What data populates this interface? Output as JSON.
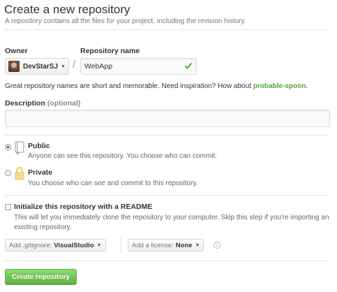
{
  "header": {
    "title": "Create a new repository",
    "subtitle": "A repository contains all the files for your project, including the revision history."
  },
  "owner": {
    "label": "Owner",
    "selected": "DevStarSJ"
  },
  "separator": "/",
  "repository_name": {
    "label": "Repository name",
    "value": "WebApp",
    "valid": true
  },
  "hint": {
    "text": "Great repository names are short and memorable. Need inspiration? How about ",
    "suggestion": "probable-spoon",
    "end": "."
  },
  "description": {
    "label": "Description",
    "optional": "(optional)",
    "value": ""
  },
  "visibility": {
    "options": [
      {
        "title": "Public",
        "description": "Anyone can see this repository. You choose who can commit.",
        "selected": true,
        "icon": "repo-book-icon"
      },
      {
        "title": "Private",
        "description": "You choose who can see and commit to this repository.",
        "selected": false,
        "icon": "lock-icon"
      }
    ]
  },
  "readme": {
    "title": "Initialize this repository with a README",
    "description": "This will let you immediately clone the repository to your computer. Skip this step if you're importing an existing repository.",
    "checked": false
  },
  "gitignore": {
    "prefix": "Add .gitignore:",
    "value": "VisualStudio"
  },
  "license": {
    "prefix": "Add a license:",
    "value": "None"
  },
  "create_button": "Create repository",
  "colors": {
    "accent_green": "#60b044",
    "link_green": "#55a532",
    "valid_check": "#55a532"
  }
}
